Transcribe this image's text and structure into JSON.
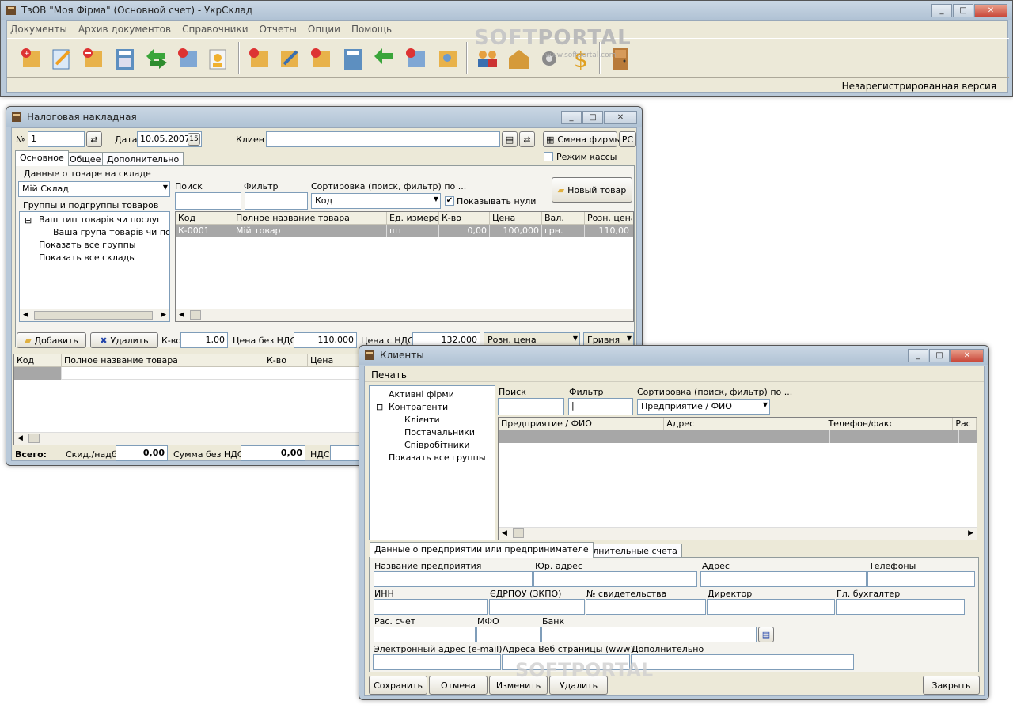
{
  "main_window": {
    "title": "ТзОВ \"Моя Фірма\" (Основной счет) - УкрСклад",
    "menu": [
      "Документы",
      "Архив документов",
      "Справочники",
      "Отчеты",
      "Опции",
      "Помощь"
    ],
    "status": "Незарегистрированная версия",
    "watermark_url": "www.softportal.com"
  },
  "invoice_window": {
    "title": "Налоговая накладная",
    "number_label": "№",
    "number_value": "1",
    "date_label": "Дата",
    "date_value": "10.05.2007",
    "calendar_label": "15",
    "client_label": "Клиент",
    "client_value": "",
    "change_firm_label": "Смена фирмы",
    "rs_label": "РС",
    "cash_mode_label": "Режим кассы",
    "tabs": [
      "Основное",
      "Общее",
      "Дополнительно"
    ],
    "goods_group_label": "Данные о товаре на складе",
    "warehouse_value": "Мій Склад",
    "groups_label": "Группы и подгруппы товаров",
    "tree": [
      "Ваш тип товарів чи послуг",
      "Ваша група товарів чи послу",
      "Показать все группы",
      "Показать все склады"
    ],
    "search_label": "Поиск",
    "filter_label": "Фильтр",
    "sort_label": "Сортировка (поиск, фильтр) по ...",
    "sort_value": "Код",
    "show_zeros_label": "Показывать нули",
    "new_product_label": "Новый товар",
    "goods_columns": [
      "Код",
      "Полное название товара",
      "Ед. измерен",
      "К-во",
      "Цена",
      "Вал.",
      "Розн. цена"
    ],
    "goods_rows": [
      [
        "К-0001",
        "Мій товар",
        "шт",
        "0,00",
        "100,000",
        "грн.",
        "110,00"
      ]
    ],
    "add_label": "Добавить",
    "delete_label": "Удалить",
    "qty_label": "К-во",
    "qty_value": "1,00",
    "price_no_vat_label": "Цена без НДС",
    "price_no_vat_value": "110,000",
    "price_vat_label": "Цена с НДС",
    "price_vat_value": "132,000",
    "price_type_value": "Розн. цена",
    "currency_value": "Гривня",
    "lines_columns": [
      "Код",
      "Полное название товара",
      "К-во",
      "Цена"
    ],
    "total_label": "Всего:",
    "discount_label": "Скид./надб.",
    "discount_value": "0,00",
    "sum_no_vat_label": "Сумма без НДС",
    "sum_no_vat_value": "0,00",
    "vat_label": "НДС"
  },
  "clients_window": {
    "title": "Клиенты",
    "menu_print": "Печать",
    "tree": [
      "Активні фірми",
      "Контрагенти",
      "Клієнти",
      "Постачальники",
      "Співробітники",
      "Показать все группы"
    ],
    "search_label": "Поиск",
    "filter_label": "Фильтр",
    "sort_label": "Сортировка (поиск, фильтр) по ...",
    "sort_value": "Предприятие / ФИО",
    "columns": [
      "Предприятие / ФИО",
      "Адрес",
      "Телефон/факс",
      "Рас"
    ],
    "tabs": [
      "Данные о предприятии или предпринимателе",
      "Дополнительные счета"
    ],
    "fields": {
      "company": "Название предприятия",
      "legal_address": "Юр. адрес",
      "address": "Адрес",
      "phones": "Телефоны",
      "inn": "ИНН",
      "edrpou": "ЄДРПОУ (ЗКПО)",
      "certificate": "№ свидетельства",
      "director": "Директор",
      "accountant": "Гл. бухгалтер",
      "account": "Рас. счет",
      "mfo": "МФО",
      "bank": "Банк",
      "email": "Электронный адрес (e-mail)",
      "web": "Адреса Веб страницы (www)",
      "extra": "Дополнительно"
    },
    "buttons": {
      "save": "Сохранить",
      "cancel": "Отмена",
      "edit": "Изменить",
      "delete": "Удалить",
      "close": "Закрыть"
    }
  },
  "colors": {
    "frame": "#b9c9d9",
    "dialog_bg": "#ece9d8",
    "selected_row": "#a7a7a7",
    "title_text": "#222222"
  }
}
